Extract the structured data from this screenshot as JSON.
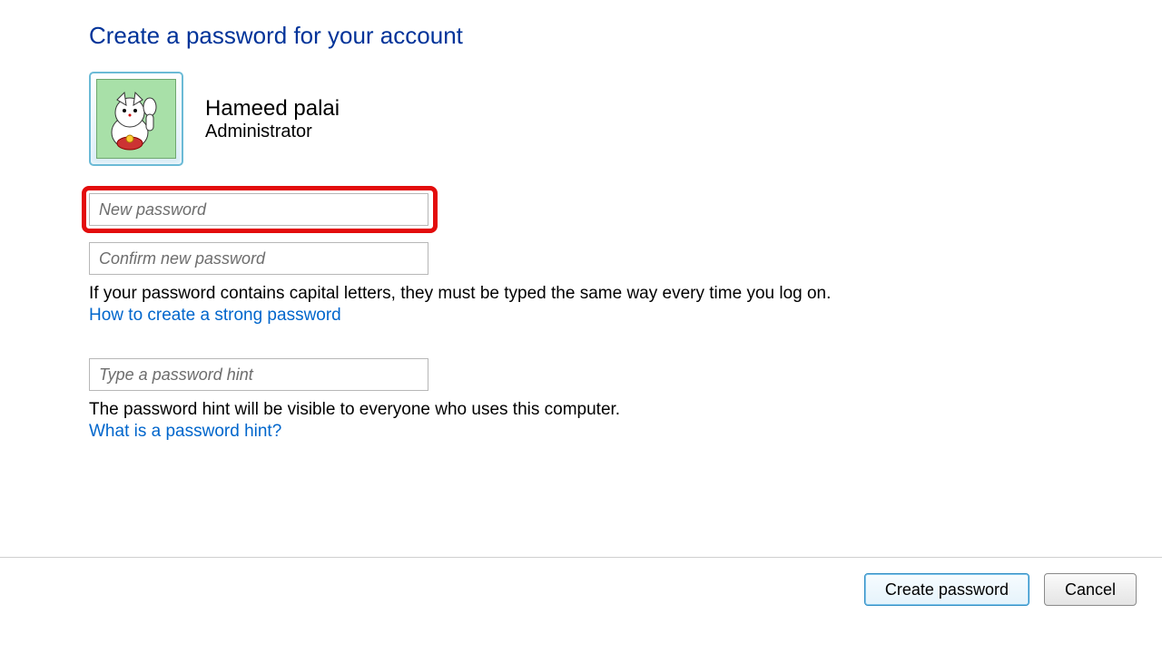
{
  "title": "Create a password for your account",
  "user": {
    "name": "Hameed palai",
    "role": "Administrator"
  },
  "fields": {
    "new_password_placeholder": "New password",
    "confirm_password_placeholder": "Confirm new password",
    "hint_placeholder": "Type a password hint"
  },
  "info": {
    "caps_note": "If your password contains capital letters, they must be typed the same way every time you log on.",
    "strong_link": "How to create a strong password",
    "hint_note": "The password hint will be visible to everyone who uses this computer.",
    "hint_link": "What is a password hint?"
  },
  "buttons": {
    "create": "Create password",
    "cancel": "Cancel"
  },
  "highlight": {
    "target": "new-password-input",
    "color": "#e30c0c"
  }
}
